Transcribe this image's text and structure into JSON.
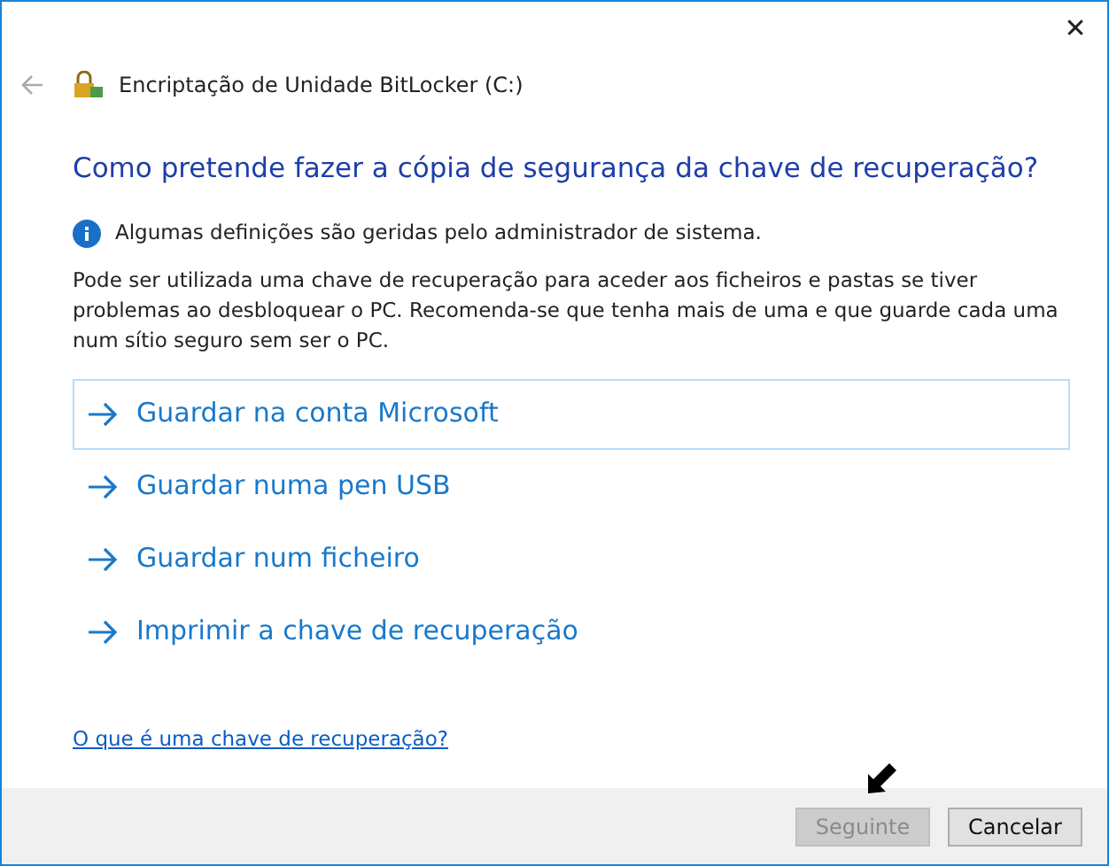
{
  "window": {
    "title": "Encriptação de Unidade BitLocker (C:)",
    "close": "✕"
  },
  "heading": "Como pretende fazer a cópia de segurança da chave de recuperação?",
  "info": "Algumas definições são geridas pelo administrador de sistema.",
  "description": "Pode ser utilizada uma chave de recuperação para aceder aos ficheiros e pastas se tiver problemas ao desbloquear o PC. Recomenda-se que tenha mais de uma e que guarde cada uma num sítio seguro sem ser o PC.",
  "options": [
    {
      "label": "Guardar na conta Microsoft",
      "selected": true
    },
    {
      "label": "Guardar numa pen USB",
      "selected": false
    },
    {
      "label": "Guardar num ficheiro",
      "selected": false
    },
    {
      "label": "Imprimir a chave de recuperação",
      "selected": false
    }
  ],
  "help_link": "O que é uma chave de recuperação?",
  "buttons": [
    {
      "label": "Seguinte",
      "disabled": true
    },
    {
      "label": "Cancelar",
      "disabled": false
    }
  ]
}
